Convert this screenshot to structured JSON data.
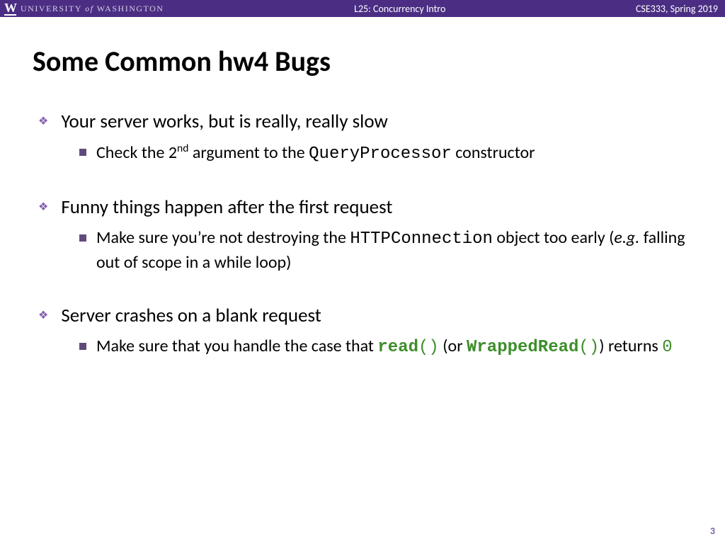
{
  "header": {
    "university_pre": "UNIVERSITY ",
    "university_of": "of",
    "university_post": " WASHINGTON",
    "center": "L25:  Concurrency Intro",
    "right": "CSE333, Spring 2019"
  },
  "title": "Some Common hw4 Bugs",
  "bullets": {
    "b1": {
      "top": "Your server works, but is really, really slow",
      "s1_pre": "Check the 2",
      "s1_sup": "nd",
      "s1_mid": " argument to the ",
      "s1_code": "QueryProcessor",
      "s1_post": " constructor"
    },
    "b2": {
      "top": "Funny things happen after the first request",
      "s1_pre": "Make sure you’re not destroying the ",
      "s1_code": "HTTPConnection",
      "s1_mid": " object too early (",
      "s1_eg": "e.g.",
      "s1_post": " falling out of scope in a while loop)"
    },
    "b3": {
      "top": "Server crashes on a blank request",
      "s1_pre": "Make sure that you handle the case that ",
      "s1_read": "read",
      "s1_paren1": "()",
      "s1_or": " (or ",
      "s1_wrapped": "WrappedRead",
      "s1_paren2": "()",
      "s1_ret": ") returns ",
      "s1_zero": "0"
    }
  },
  "page_number": "3"
}
